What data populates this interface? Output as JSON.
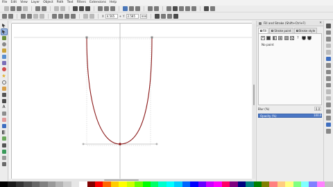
{
  "menu": [
    "File",
    "Edit",
    "View",
    "Layer",
    "Object",
    "Path",
    "Text",
    "Filters",
    "Extensions",
    "Help"
  ],
  "tool_controls": {
    "x_value": "4.565",
    "y_value": "2.585",
    "sep_label": "+",
    "unit": "mm"
  },
  "dock": {
    "title": "Fill and Stroke (Shift+Ctrl+F)",
    "close_glyph": "✕",
    "tabs": [
      "Fill",
      "Stroke paint",
      "Stroke style"
    ],
    "paint_label": "No paint",
    "blur_label": "Blur (%)",
    "blur_value": "0.0",
    "opacity_label": "Opacity (%)",
    "opacity_value": "100.0"
  },
  "colors": {
    "curve": "#8b1a1a",
    "guide": "#a7a7a7",
    "accent": "#4a76c4"
  },
  "icons": {
    "fill_types": [
      "no-paint-icon",
      "flat-color-icon",
      "linear-gradient-icon",
      "radial-gradient-icon",
      "mesh-gradient-icon",
      "pattern-icon",
      "swatch-icon",
      "unset-icon"
    ]
  }
}
